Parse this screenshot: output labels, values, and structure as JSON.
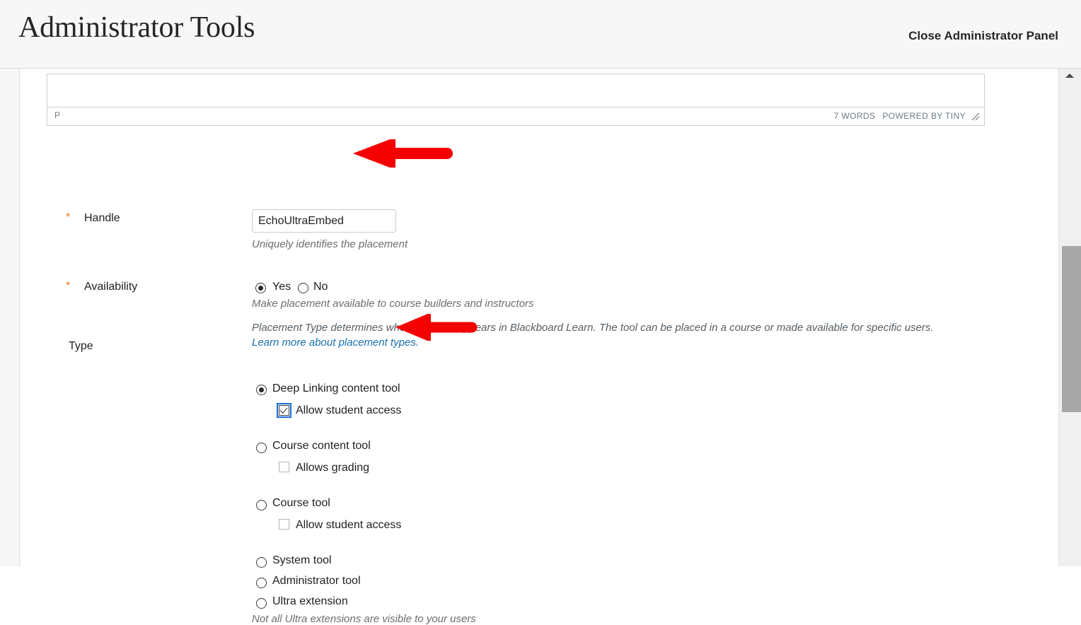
{
  "header": {
    "title": "Administrator Tools",
    "close_panel_label": "Close Administrator Panel"
  },
  "editor": {
    "status_path": "P",
    "word_count": "7 WORDS",
    "branding": "POWERED BY TINY",
    "resize_grip_icon": "resize-grip-icon"
  },
  "form": {
    "handle": {
      "required_marker": "*",
      "label": "Handle",
      "value": "EchoUltraEmbed",
      "placeholder": "",
      "helper": "Uniquely identifies the placement"
    },
    "availability": {
      "required_marker": "*",
      "label": "Availability",
      "options": [
        {
          "label": "Yes",
          "checked": true
        },
        {
          "label": "No",
          "checked": false
        }
      ],
      "helper": "Make placement available to course builders and instructors"
    },
    "type": {
      "label": "Type",
      "description": "Placement Type determines where this tool appears in Blackboard Learn. The tool can be placed in a course or made available for specific users.",
      "link_text": "Learn more about placement types.",
      "options": [
        {
          "label": "Deep Linking content tool",
          "checked": true,
          "sub": {
            "label": "Allow student access",
            "checked": true,
            "focused": true,
            "enabled": true
          }
        },
        {
          "label": "Course content tool",
          "checked": false,
          "sub": {
            "label": "Allows grading",
            "checked": false,
            "focused": false,
            "enabled": false
          }
        },
        {
          "label": "Course tool",
          "checked": false,
          "sub": {
            "label": "Allow student access",
            "checked": false,
            "focused": false,
            "enabled": false
          }
        },
        {
          "label": "System tool",
          "checked": false
        },
        {
          "label": "Administrator tool",
          "checked": false
        },
        {
          "label": "Ultra extension",
          "checked": false
        }
      ],
      "ultra_helper": "Not all Ultra extensions are visible to your users"
    }
  },
  "annotations": {
    "arrow_color": "#f50000",
    "arrow_handle_name": "annotation-arrow-handle",
    "arrow_deeplink_name": "annotation-arrow-deep-linking"
  },
  "scrollbar": {
    "up_arrow_icon": "chevron-up-icon"
  },
  "colors": {
    "required_star": "#e87722",
    "link": "#1a6fad",
    "focus_ring": "#1a6dd4",
    "header_bg": "#f7f7f7"
  }
}
